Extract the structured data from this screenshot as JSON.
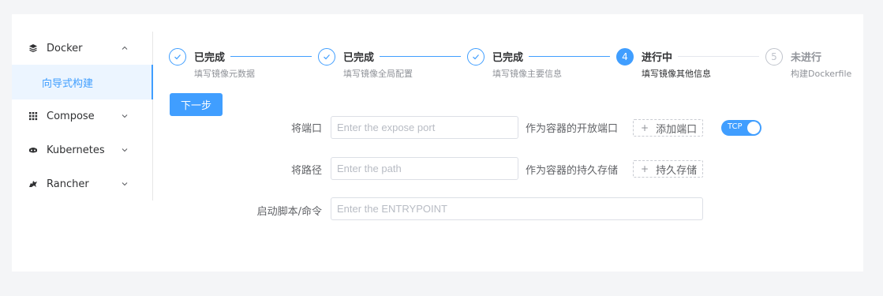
{
  "sidebar": {
    "docker": {
      "label": "Docker",
      "icon": "layers-icon",
      "expanded": true
    },
    "docker_sub": {
      "label": "向导式构建",
      "active": true
    },
    "compose": {
      "label": "Compose",
      "icon": "grid-icon"
    },
    "kubernetes": {
      "label": "Kubernetes",
      "icon": "kubernetes-icon"
    },
    "rancher": {
      "label": "Rancher",
      "icon": "rancher-icon"
    }
  },
  "steps": [
    {
      "status": "done",
      "title": "已完成",
      "desc": "填写镜像元数据"
    },
    {
      "status": "done",
      "title": "已完成",
      "desc": "填写镜像全局配置"
    },
    {
      "status": "done",
      "title": "已完成",
      "desc": "填写镜像主要信息"
    },
    {
      "status": "active",
      "number": "4",
      "title": "进行中",
      "desc": "填写镜像其他信息"
    },
    {
      "status": "pending",
      "number": "5",
      "title": "未进行",
      "desc": "构建Dockerfile"
    }
  ],
  "next_button": "下一步",
  "form": {
    "port": {
      "label": "将端口",
      "placeholder": "Enter the expose port",
      "hint": "作为容器的开放端口",
      "add_label": "添加端口",
      "protocol": "TCP"
    },
    "path": {
      "label": "将路径",
      "placeholder": "Enter the path",
      "hint": "作为容器的持久存储",
      "add_label": "持久存储"
    },
    "entrypoint": {
      "label": "启动脚本/命令",
      "placeholder": "Enter the ENTRYPOINT"
    }
  },
  "colors": {
    "primary": "#409eff",
    "muted": "#909399",
    "border": "#dcdfe6",
    "active_bg": "#ecf5ff"
  }
}
